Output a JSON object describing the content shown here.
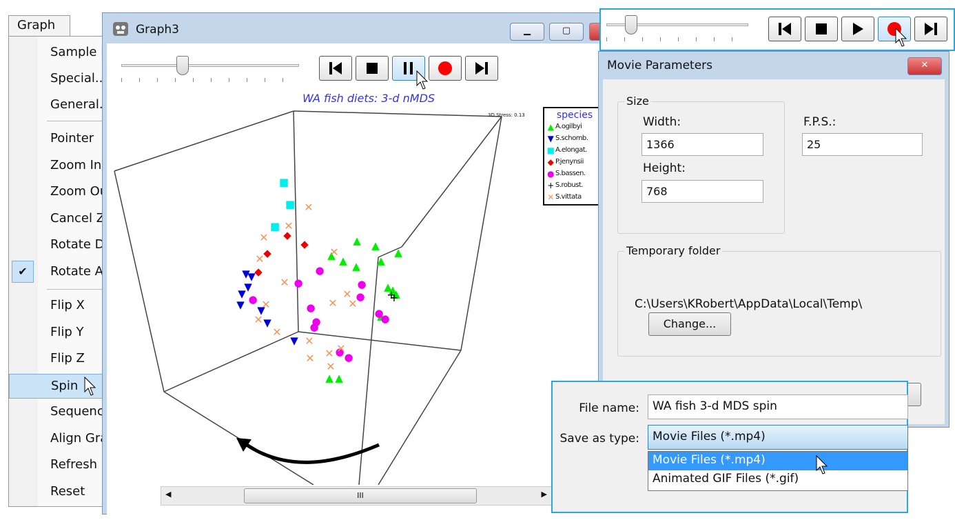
{
  "menu": {
    "tab": "Graph",
    "items": [
      {
        "label": "Sample labels & symbols"
      },
      {
        "label": "Special..."
      },
      {
        "label": "General..."
      },
      {
        "label": "Pointer"
      },
      {
        "label": "Zoom In"
      },
      {
        "label": "Zoom Out"
      },
      {
        "label": "Cancel Zoom"
      },
      {
        "label": "Rotate Discrete"
      },
      {
        "label": "Rotate Auto",
        "checked": true
      },
      {
        "label": "Flip X"
      },
      {
        "label": "Flip Y"
      },
      {
        "label": "Flip Z"
      },
      {
        "label": "Spin",
        "highlighted": true
      },
      {
        "label": "Sequence"
      },
      {
        "label": "Align Graph"
      },
      {
        "label": "Refresh"
      },
      {
        "label": "Reset"
      }
    ]
  },
  "graph_window": {
    "title": "Graph3",
    "icon": "app-bear-icon",
    "controls": [
      "minimize",
      "maximize",
      "close"
    ],
    "player": {
      "slider_position": 0.35,
      "buttons": [
        "skip-to-start",
        "stop",
        "pause",
        "record",
        "skip-to-end"
      ],
      "active": "pause"
    },
    "plot_title": "WA fish diets: 3-d nMDS",
    "stress": "3D Stress: 0.13",
    "legend": {
      "title": "species",
      "entries": [
        {
          "label": "A.ogilbyi",
          "marker": "triangle-up",
          "color": "#00ee00"
        },
        {
          "label": "S.schomb.",
          "marker": "triangle-down",
          "color": "#0000dd"
        },
        {
          "label": "A.elongat.",
          "marker": "square",
          "color": "#00eeee"
        },
        {
          "label": "P.jenynsii",
          "marker": "diamond",
          "color": "#ee0000"
        },
        {
          "label": "S.bassen.",
          "marker": "circle",
          "color": "#ee00ee"
        },
        {
          "label": "S.robust.",
          "marker": "plus",
          "color": "#000000"
        },
        {
          "label": "S.vittata",
          "marker": "cross",
          "color": "#f4955a"
        }
      ]
    },
    "scrollbar_grip": "III"
  },
  "toolbar_panel": {
    "slider_position": 0.17,
    "buttons": [
      "skip-to-start",
      "stop",
      "play",
      "record",
      "skip-to-end"
    ],
    "active": "record"
  },
  "movie_dialog": {
    "title": "Movie Parameters",
    "size_group": "Size",
    "width_label": "Width:",
    "width": "1366",
    "height_label": "Height:",
    "height": "768",
    "fps_label": "F.P.S.:",
    "fps": "25",
    "temp_group": "Temporary folder",
    "temp_path": "C:\\Users\\KRobert\\AppData\\Local\\Temp\\",
    "change_button": "Change..."
  },
  "save_panel": {
    "file_name_label": "File name:",
    "file_name": "WA fish 3-d MDS spin",
    "type_label": "Save as type:",
    "type_selected": "Movie Files (*.mp4)",
    "type_options": [
      "Movie Files (*.mp4)",
      "Animated GIF Files (*.gif)"
    ]
  }
}
